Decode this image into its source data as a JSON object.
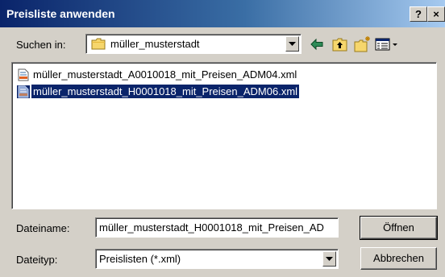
{
  "window": {
    "title": "Preisliste anwenden",
    "help_label": "?",
    "close_label": "×"
  },
  "lookin": {
    "label": "Suchen in:",
    "value": "müller_musterstadt",
    "icon": "folder-icon"
  },
  "toolbar": {
    "items": [
      "back-arrow-icon",
      "up-folder-icon",
      "new-folder-icon",
      "view-menu-icon"
    ]
  },
  "files": [
    {
      "name": "müller_musterstadt_A0010018_mit_Preisen_ADM04.xml",
      "icon": "xml-file-icon",
      "selected": false
    },
    {
      "name": "müller_musterstadt_H0001018_mit_Preisen_ADM06.xml",
      "icon": "xml-file-icon",
      "selected": true
    }
  ],
  "filename": {
    "label": "Dateiname:",
    "value": "müller_musterstadt_H0001018_mit_Preisen_AD"
  },
  "filetype": {
    "label": "Dateityp:",
    "value": "Preislisten (*.xml)"
  },
  "buttons": {
    "open": "Öffnen",
    "cancel": "Abbrechen"
  },
  "colors": {
    "title_bar": "#0a246a",
    "selection": "#0a246a",
    "dialog_face": "#d4d0c8"
  }
}
